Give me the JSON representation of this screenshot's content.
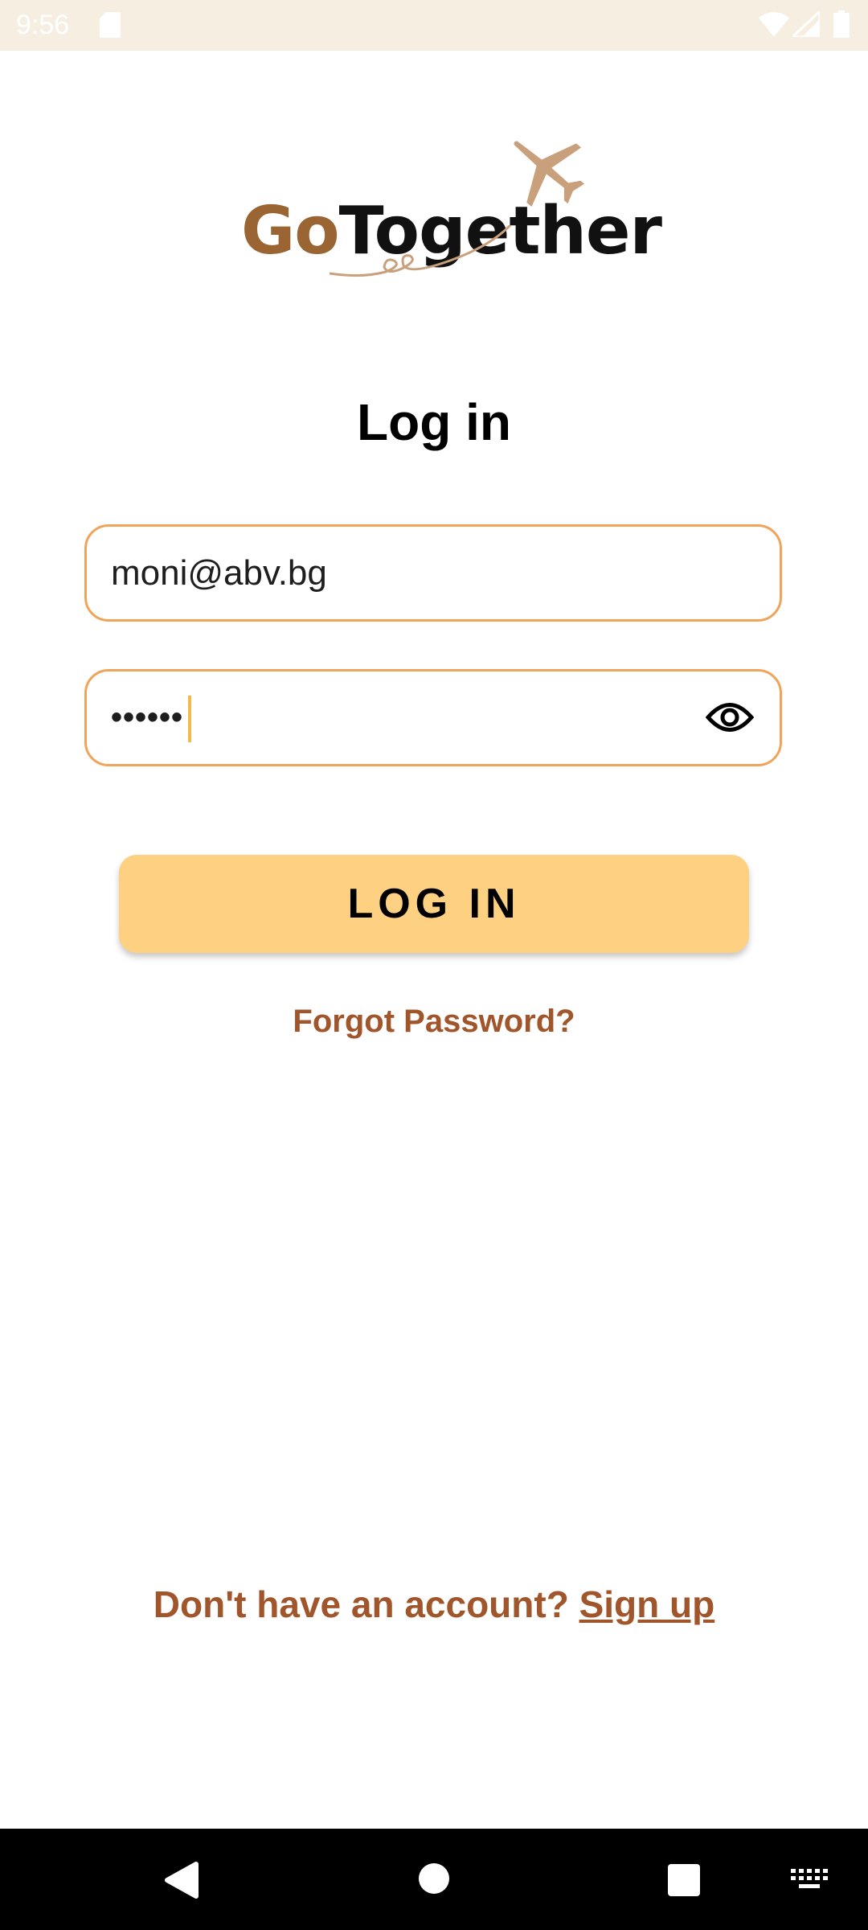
{
  "status_bar": {
    "time": "9:56",
    "icons": [
      "sd-card-icon",
      "wifi-icon",
      "signal-icon",
      "battery-icon"
    ]
  },
  "logo": {
    "part_go": "Go",
    "part_together": "Together",
    "icon": "airplane-icon",
    "colors": {
      "go": "#9a6533",
      "together": "#111111",
      "plane": "#c9a07c"
    }
  },
  "page": {
    "title": "Log in"
  },
  "form": {
    "email_value": "moni@abv.bg",
    "password_value": "••••••",
    "password_icon": "eye-icon",
    "field_border_color": "#f0a45a"
  },
  "actions": {
    "login_label": "LOG IN",
    "login_color": "#fdd181",
    "forgot_label": "Forgot Password?",
    "signup_prompt": "Don't have an account? ",
    "signup_label": "Sign up",
    "link_color": "#a0552b"
  },
  "nav_bar": {
    "icons": [
      "back-icon",
      "home-icon",
      "recents-icon",
      "keyboard-icon"
    ]
  }
}
